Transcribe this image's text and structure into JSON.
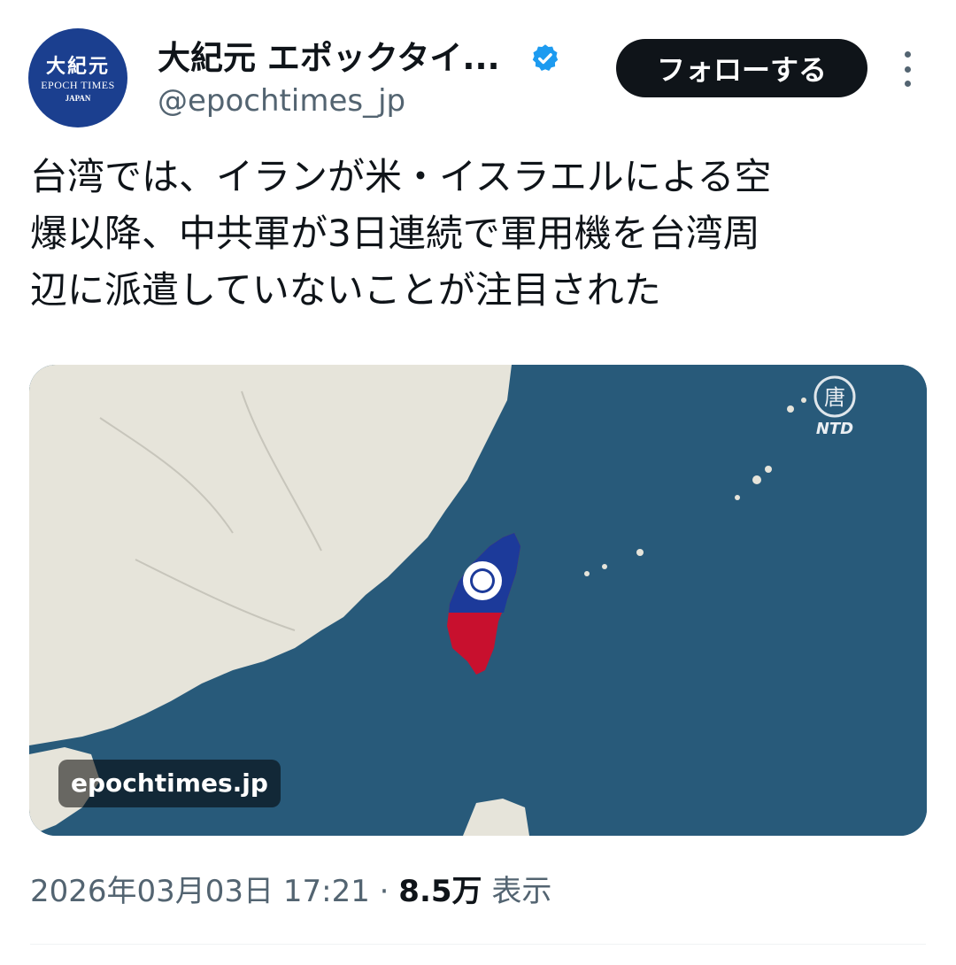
{
  "account": {
    "display_name": "大紀元 エポックタイ...",
    "handle": "@epochtimes_jp",
    "verified": true,
    "avatar_logo": {
      "cjk": "大紀元",
      "en": "EPOCH TIMES",
      "sub": "JAPAN"
    }
  },
  "follow_button_label": "フォローする",
  "tweet_text": "台湾では、イランが米・イスラエルによる空\n爆以降、中共軍が3日連続で軍用機を台湾周\n辺に派遣していないことが注目された",
  "media": {
    "caption": "epochtimes.jp",
    "watermark_text": "NTD",
    "watermark_icon": "ntd-logo",
    "colors": {
      "sea": "#285a7a",
      "land": "#e6e4da",
      "flag_blue": "#1c3a9a",
      "flag_red": "#c8102e"
    }
  },
  "meta": {
    "timestamp": "2026年03月03日 17:21",
    "separator": "·",
    "views_count": "8.5万",
    "views_label": "表示"
  },
  "colors": {
    "primary_text": "#0f1419",
    "secondary_text": "#536471",
    "verified_blue": "#1d9bf0",
    "button_bg": "#0f1419"
  }
}
